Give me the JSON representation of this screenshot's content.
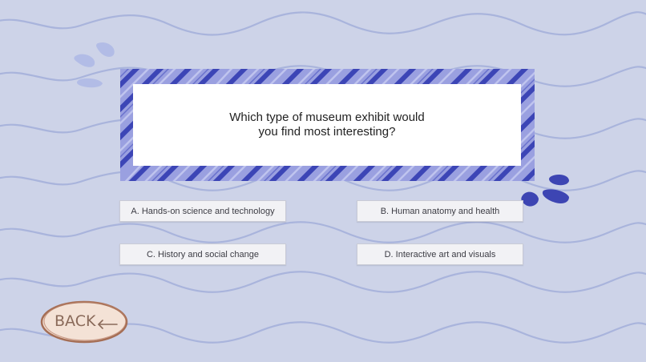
{
  "question": {
    "text": "Which type of museum exhibit would you find most interesting?"
  },
  "answers": [
    {
      "label": "A. Hands-on science and technology"
    },
    {
      "label": "B. Human anatomy and health"
    },
    {
      "label": "C. History and social change"
    },
    {
      "label": "D. Interactive art and visuals"
    }
  ],
  "back_button": {
    "label": "BACK",
    "arrow_icon": "left-arrow-icon"
  },
  "colors": {
    "background": "#cdd3e8",
    "wave": "#a8b3dc",
    "frame_stripe": "#3f48b8",
    "splash": "#3d45b3",
    "card": "#ffffff",
    "back_fill": "#f4e2d6",
    "back_outline": "#a56e55"
  }
}
